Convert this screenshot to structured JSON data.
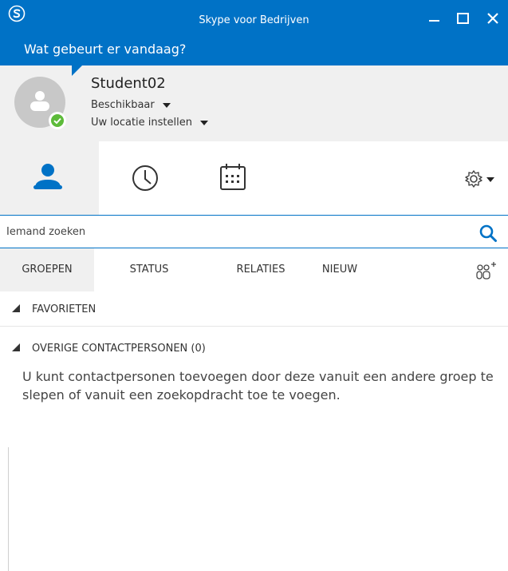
{
  "window": {
    "title": "Skype voor Bedrijven",
    "banner": "Wat gebeurt er vandaag?"
  },
  "profile": {
    "name": "Student02",
    "status": "Beschikbaar",
    "location": "Uw locatie instellen"
  },
  "tabs": [
    {
      "name": "contacts",
      "icon": "person-icon",
      "selected": true
    },
    {
      "name": "recent",
      "icon": "clock-icon",
      "selected": false
    },
    {
      "name": "meetings",
      "icon": "calendar-icon",
      "selected": false
    }
  ],
  "search": {
    "placeholder": "Iemand zoeken"
  },
  "views": {
    "groups": "GROEPEN",
    "status": "STATUS",
    "relations": "RELATIES",
    "new": "NIEUW"
  },
  "groups": [
    {
      "label": "FAVORIETEN"
    },
    {
      "label": "OVERIGE CONTACTPERSONEN (0)"
    }
  ],
  "empty_message": "U kunt contactpersonen toevoegen door deze vanuit een andere groep te slepen of vanuit een zoekopdracht toe te voegen.",
  "colors": {
    "accent": "#0072c6",
    "presence": "#5dbb3a",
    "panel_bg": "#f0f0f0"
  }
}
